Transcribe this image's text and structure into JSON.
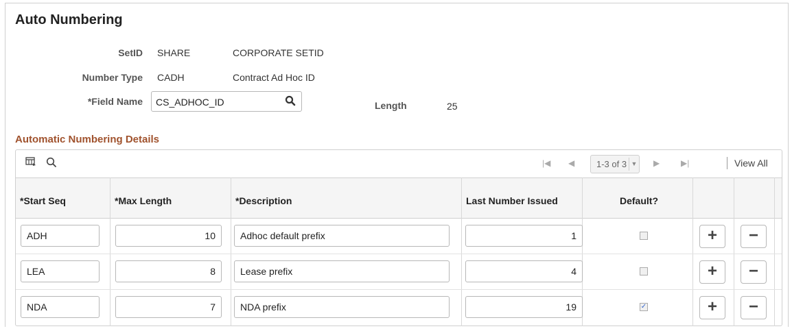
{
  "page_title": "Auto Numbering",
  "header": {
    "setid_label": "SetID",
    "setid_value": "SHARE",
    "setid_desc": "CORPORATE SETID",
    "number_type_label": "Number Type",
    "number_type_value": "CADH",
    "number_type_desc": "Contract Ad Hoc ID",
    "field_name_label": "*Field Name",
    "field_name_value": "CS_ADHOC_ID",
    "length_label": "Length",
    "length_value": "25"
  },
  "section_title": "Automatic Numbering Details",
  "grid": {
    "pager_text": "1-3 of 3",
    "view_all": "View All",
    "columns": [
      "*Start Seq",
      "*Max Length",
      "*Description",
      "Last Number Issued",
      "Default?"
    ],
    "rows": [
      {
        "start_seq": "ADH",
        "max_length": "10",
        "description": "Adhoc default prefix",
        "last_number": "1",
        "default": false
      },
      {
        "start_seq": "LEA",
        "max_length": "8",
        "description": "Lease prefix",
        "last_number": "4",
        "default": false
      },
      {
        "start_seq": "NDA",
        "max_length": "7",
        "description": "NDA prefix",
        "last_number": "19",
        "default": true
      }
    ]
  },
  "icons": {
    "search": "magnifier",
    "personalize": "grid-settings",
    "add": "+",
    "delete": "−"
  },
  "colors": {
    "section_title": "#a0522d",
    "checkbox_check": "#3366cc"
  }
}
